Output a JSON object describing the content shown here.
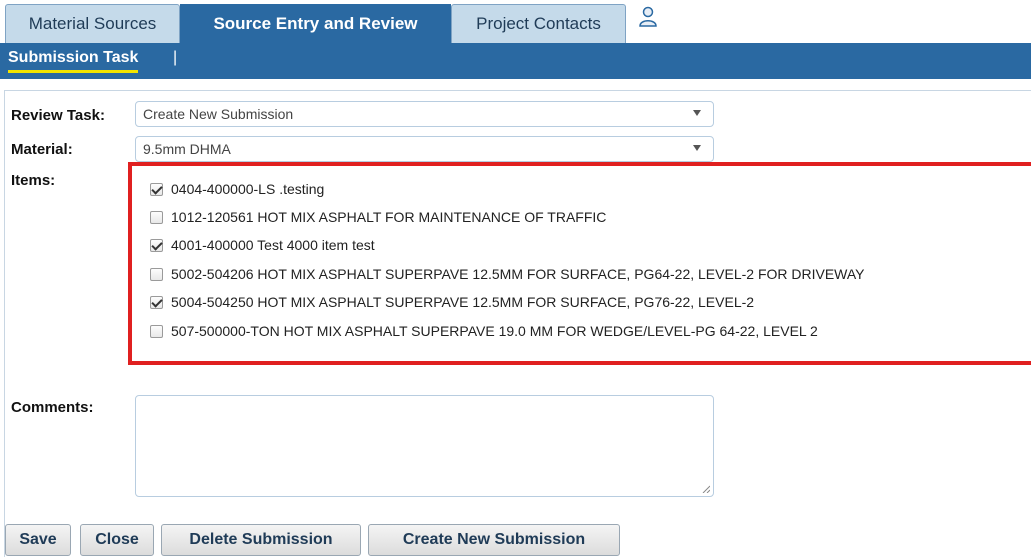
{
  "tabs": [
    {
      "label": "Material Sources",
      "active": false
    },
    {
      "label": "Source Entry and Review",
      "active": true
    },
    {
      "label": "Project Contacts",
      "active": false
    }
  ],
  "subnav": {
    "item": "Submission Task",
    "separator": "|"
  },
  "form": {
    "review_task": {
      "label": "Review Task:",
      "value": "Create New Submission"
    },
    "material": {
      "label": "Material:",
      "value": "9.5mm DHMA"
    },
    "items_label": "Items:",
    "items": [
      {
        "text": "0404-400000-LS .testing",
        "checked": true
      },
      {
        "text": "1012-120561 HOT MIX ASPHALT FOR MAINTENANCE OF TRAFFIC",
        "checked": false
      },
      {
        "text": "4001-400000 Test 4000 item test",
        "checked": true
      },
      {
        "text": "5002-504206 HOT MIX ASPHALT SUPERPAVE 12.5MM FOR SURFACE, PG64-22, LEVEL-2 FOR DRIVEWAY",
        "checked": false
      },
      {
        "text": "5004-504250 HOT MIX ASPHALT SUPERPAVE 12.5MM FOR SURFACE, PG76-22, LEVEL-2",
        "checked": true
      },
      {
        "text": "507-500000-TON HOT MIX ASPHALT SUPERPAVE 19.0 MM FOR WEDGE/LEVEL-PG 64-22, LEVEL 2",
        "checked": false
      }
    ],
    "comments_label": "Comments:",
    "comments_value": ""
  },
  "buttons": {
    "save": "Save",
    "close": "Close",
    "delete": "Delete Submission",
    "create": "Create New Submission"
  },
  "colors": {
    "nav_blue": "#2a69a2",
    "tab_inactive": "#c5daea",
    "highlight_red": "#e02020",
    "underline_yellow": "#f2e400"
  },
  "icons": {
    "user": "user-icon",
    "dropdown": "chevron-down-icon"
  }
}
